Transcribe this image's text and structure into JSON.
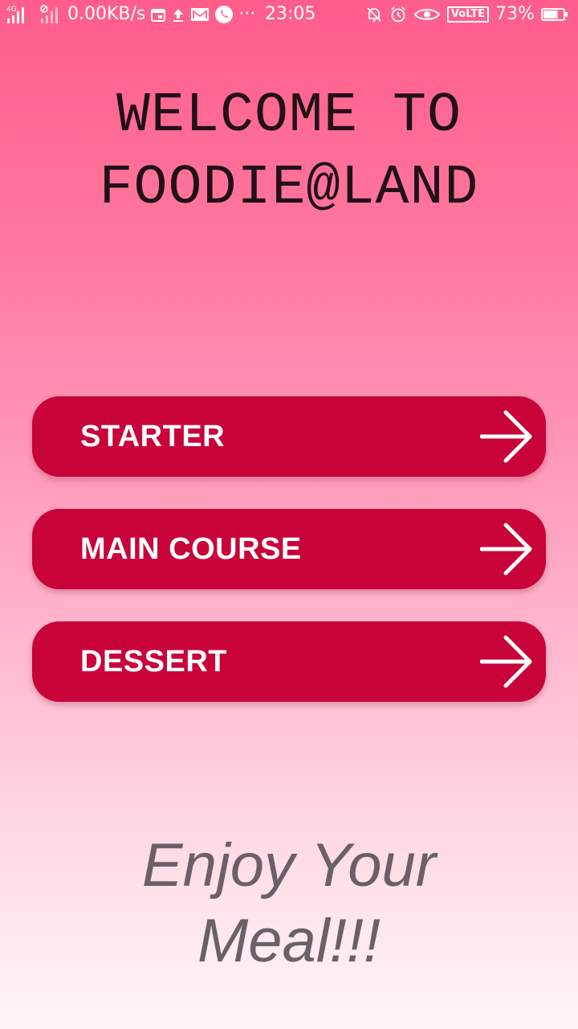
{
  "status_bar": {
    "network_label": "4G",
    "speed": "0.00KB/s",
    "time": "23:05",
    "dots": "···",
    "volte": "VoLTE",
    "battery_percent": "73%",
    "battery_level": 0.73
  },
  "title": {
    "line1": "WELCOME TO",
    "line2": "FOODIE@LAND"
  },
  "menu": [
    {
      "label": "STARTER",
      "icon": "arrow-right-icon"
    },
    {
      "label": "MAIN COURSE",
      "icon": "arrow-right-icon"
    },
    {
      "label": "DESSERT",
      "icon": "arrow-right-icon"
    }
  ],
  "footer": {
    "line1": "Enjoy Your",
    "line2": "Meal!!!"
  },
  "colors": {
    "button": "#c8033a",
    "gradient_top": "#ff5d8b",
    "gradient_bottom": "#fff6f9",
    "title_text": "#221018",
    "footer_text": "#6b6068"
  }
}
